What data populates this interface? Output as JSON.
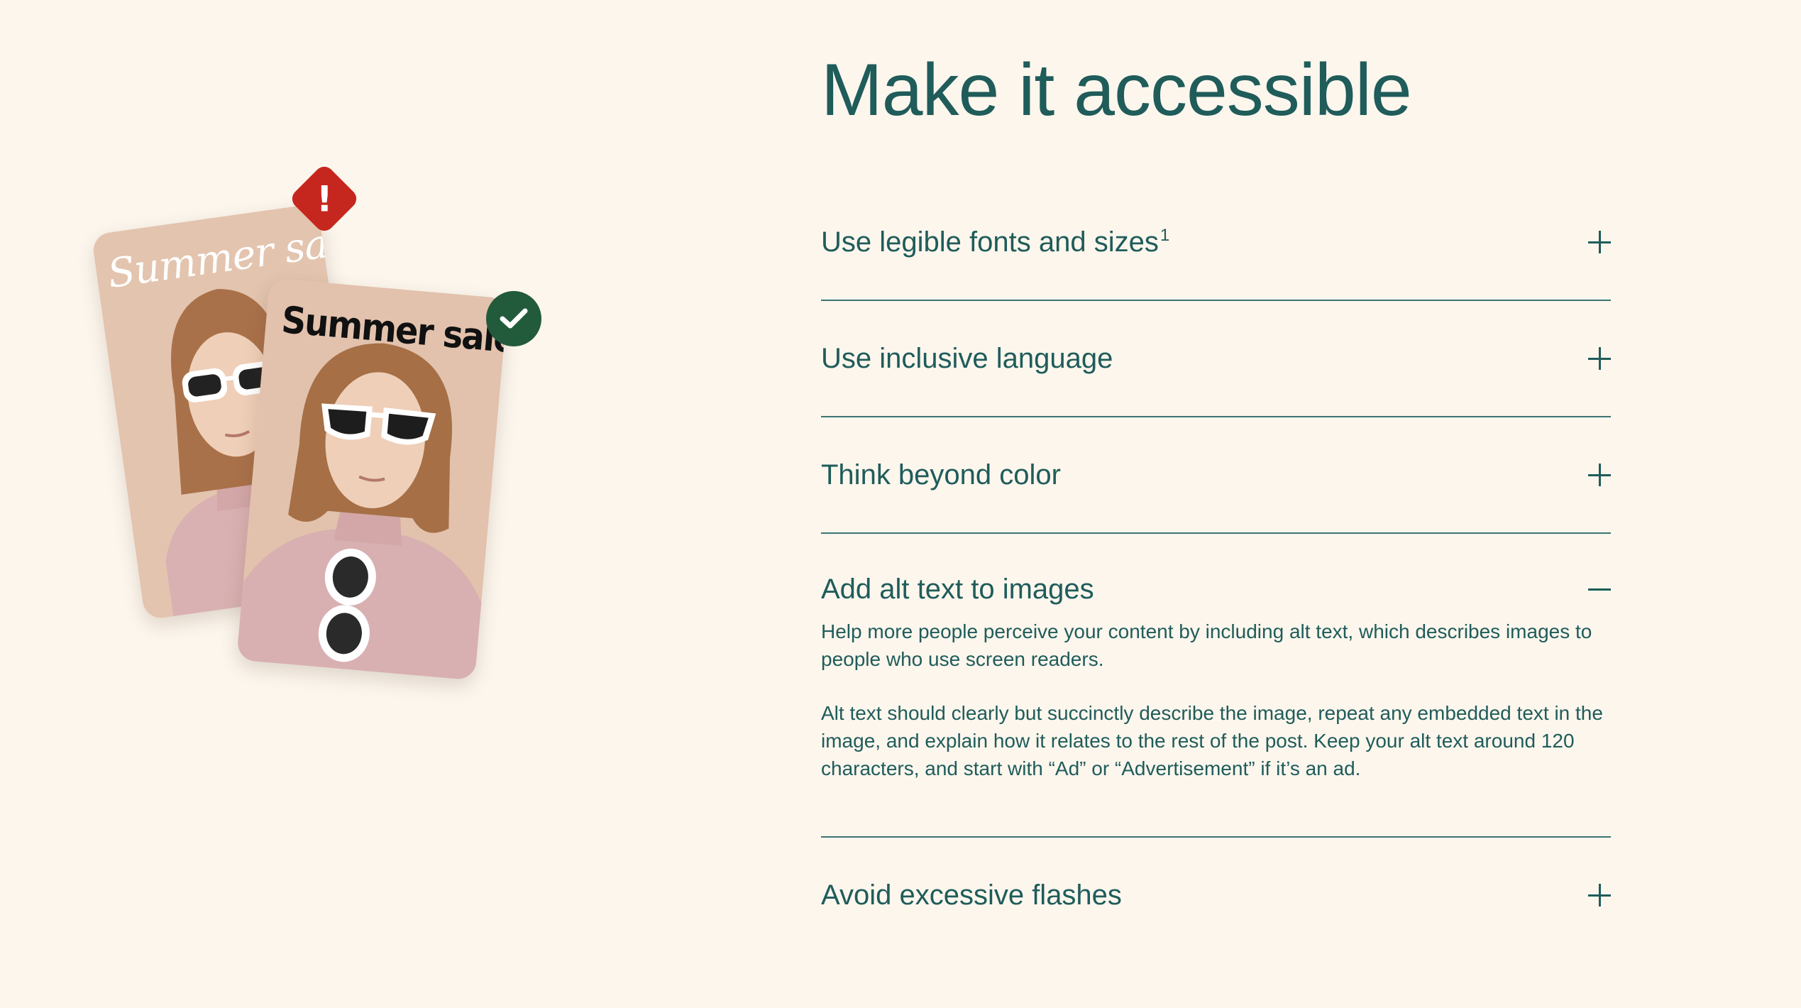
{
  "title": "Make it accessible",
  "illustration": {
    "bad_example_text": "Summer sale",
    "good_example_text": "Summer sale",
    "warning_icon": "exclamation-diamond-icon",
    "check_icon": "checkmark-circle-icon",
    "warning_glyph": "!",
    "colors": {
      "warning": "#c5271f",
      "success": "#225b3b",
      "card_background": "#e2c2ad"
    }
  },
  "accordion": {
    "items": [
      {
        "label": "Use legible fonts and sizes",
        "footnote": "1",
        "expanded": false,
        "icon": "plus-icon"
      },
      {
        "label": "Use inclusive language",
        "expanded": false,
        "icon": "plus-icon"
      },
      {
        "label": "Think beyond color",
        "expanded": false,
        "icon": "plus-icon"
      },
      {
        "label": "Add alt text to images",
        "expanded": true,
        "icon": "minus-icon",
        "paragraphs": [
          "Help more people perceive your content by including alt text, which describes images to people who use screen readers.",
          "Alt text should clearly but succinctly describe the image, repeat any embedded text in the image, and explain how it relates to the rest of the post. Keep your alt text around 120 characters, and start with “Ad” or “Advertisement” if it’s an ad."
        ]
      },
      {
        "label": "Avoid excessive flashes",
        "expanded": false,
        "icon": "plus-icon"
      }
    ]
  },
  "colors": {
    "page_background": "#fcf6ed",
    "text_primary": "#1f5c5a"
  }
}
